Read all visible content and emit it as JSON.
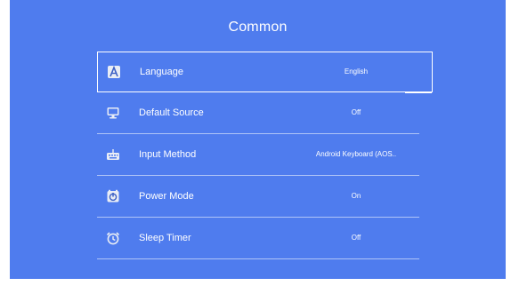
{
  "page": {
    "title": "Common"
  },
  "settings": [
    {
      "label": "Language",
      "value": "English",
      "icon": "language-icon",
      "selected": true
    },
    {
      "label": "Default Source",
      "value": "Off",
      "icon": "monitor-icon",
      "selected": false
    },
    {
      "label": "Input Method",
      "value": "Android Keyboard (AOS..",
      "icon": "keyboard-icon",
      "selected": false
    },
    {
      "label": "Power Mode",
      "value": "On",
      "icon": "power-mode-icon",
      "selected": false
    },
    {
      "label": "Sleep Timer",
      "value": "Off",
      "icon": "alarm-clock-icon",
      "selected": false
    }
  ],
  "colors": {
    "background": "#4f7cee",
    "text": "#ffffff"
  }
}
